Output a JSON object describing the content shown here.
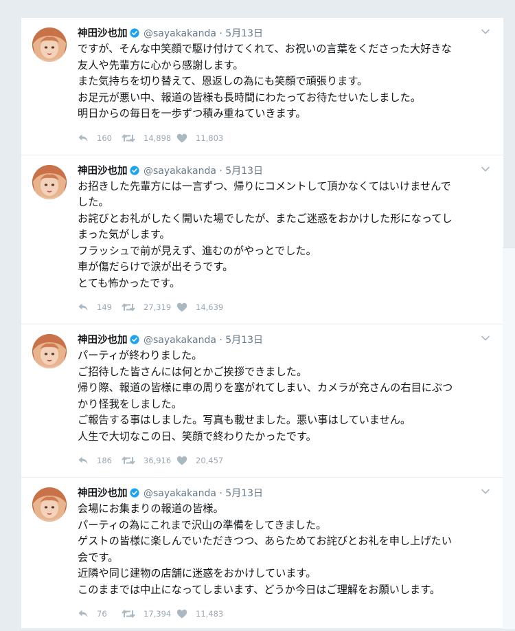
{
  "tweets": [
    {
      "name": "神田沙也加",
      "handle": "@sayakakanda",
      "separator": "·",
      "date": "5月13日",
      "lines": [
        "ですが、そんな中笑顔で駆け付けてくれて、お祝いの言葉をくださった大好きな",
        "友人や先輩方に心から感謝します。",
        "また気持ちを切り替えて、恩返しの為にも笑顔で頑張ります。",
        "お足元が悪い中、報道の皆様も長時間にわたってお待たせいたしました。",
        "明日からの毎日を一歩ずつ積み重ねていきます。"
      ],
      "replies": "160",
      "retweets": "14,898",
      "likes": "11,803"
    },
    {
      "name": "神田沙也加",
      "handle": "@sayakakanda",
      "separator": "·",
      "date": "5月13日",
      "lines": [
        "お招きした先輩方には一言ずつ、帰りにコメントして頂かなくてはいけませんで",
        "した。",
        "お詫びとお礼がしたく開いた場でしたが、またご迷惑をおかけした形になってし",
        "まった気がします。",
        "フラッシュで前が見えず、進むのがやっとでした。",
        "車が傷だらけで涙が出そうです。",
        "とても怖かったです。"
      ],
      "replies": "149",
      "retweets": "27,319",
      "likes": "14,639"
    },
    {
      "name": "神田沙也加",
      "handle": "@sayakakanda",
      "separator": "·",
      "date": "5月13日",
      "lines": [
        "パーティが終わりました。",
        "ご招待した皆さんには何とかご挨拶できました。",
        "帰り際、報道の皆様に車の周りを塞がれてしまい、カメラが充さんの右目にぶつ",
        "かり怪我をしました。",
        "ご報告する事はしました。写真も載せました。悪い事はしていません。",
        "人生で大切なこの日、笑顔で終わりたかったです。"
      ],
      "replies": "186",
      "retweets": "36,916",
      "likes": "20,457"
    },
    {
      "name": "神田沙也加",
      "handle": "@sayakakanda",
      "separator": "·",
      "date": "5月13日",
      "lines": [
        "会場にお集まりの報道の皆様。",
        "パーティの為にこれまで沢山の準備をしてきました。",
        "ゲストの皆様に楽しんでいただきつつ、あらためてお詫びとお礼を申し上げたい",
        "会です。",
        "近隣や同じ建物の店舗に迷惑をおかけしています。",
        "このままでは中止になってしまいます、どうか今日はご理解をお願いします。"
      ],
      "replies": "76",
      "retweets": "17,394",
      "likes": "11,483"
    }
  ],
  "colors": {
    "verified": "#1da1f2",
    "muted": "#657786",
    "action_icon": "#aab8c2",
    "background": "#e6ecf0"
  },
  "icons": {
    "verified": "verified-badge-icon",
    "caret": "chevron-down-icon",
    "reply": "reply-icon",
    "retweet": "retweet-icon",
    "like": "heart-icon"
  }
}
